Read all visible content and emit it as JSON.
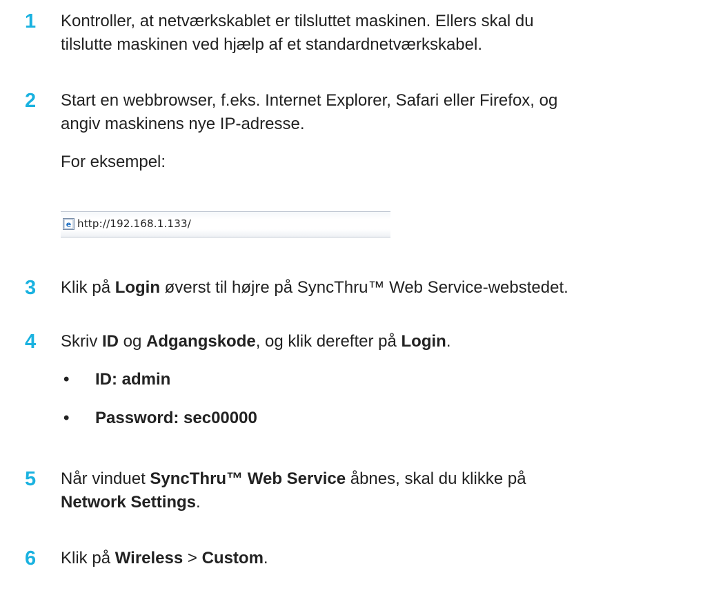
{
  "steps": [
    {
      "number": "1",
      "lines": [
        "Kontroller, at netværkskablet er tilsluttet maskinen. Ellers skal du",
        "tilslutte maskinen ved hjælp af et standardnetværkskabel."
      ]
    },
    {
      "number": "2",
      "lines": [
        "Start en webbrowser, f.eks. Internet Explorer, Safari eller Firefox, og",
        "angiv maskinens nye IP-adresse."
      ],
      "example_label": "For eksempel:"
    },
    {
      "number": "3",
      "parts": [
        "Klik på ",
        "Login",
        " øverst til højre på SyncThru™ Web Service-webstedet."
      ]
    },
    {
      "number": "4",
      "parts": [
        "Skriv ",
        "ID",
        " og ",
        "Adgangskode",
        ", og klik derefter på ",
        "Login",
        "."
      ],
      "bullets": [
        "ID: admin",
        "Password: sec00000"
      ]
    },
    {
      "number": "5",
      "line1": [
        "Når vinduet ",
        "SyncThru™ Web Service",
        " åbnes, skal du klikke på"
      ],
      "line2": [
        "Network Settings",
        "."
      ]
    },
    {
      "number": "6",
      "parts": [
        "Klik på ",
        "Wireless",
        " > ",
        "Custom",
        "."
      ]
    }
  ],
  "address_bar": {
    "url": "http://192.168.1.133/",
    "icon": "ie-page-icon"
  },
  "colors": {
    "step_number": "#1ab2e0",
    "text": "#222222"
  }
}
